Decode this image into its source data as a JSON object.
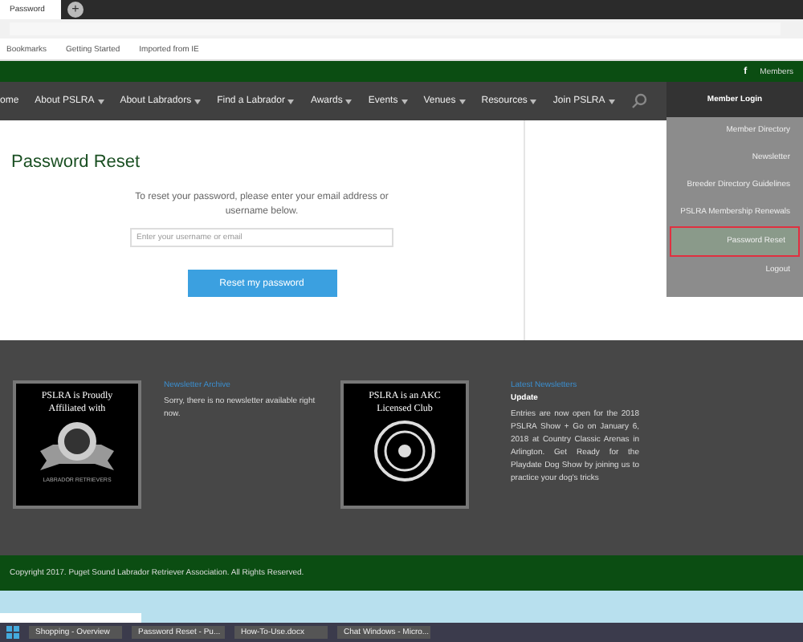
{
  "browser": {
    "tabs": [
      {
        "label": "Password",
        "selected": true
      }
    ],
    "new_tab": "+",
    "bookmarks": [
      "Bookmarks",
      "Getting Started",
      "Imported from IE"
    ]
  },
  "top_bar": {
    "facebook": "f",
    "members": "Members"
  },
  "nav": {
    "items": [
      {
        "label": "ome",
        "dropdown": false
      },
      {
        "label": "About PSLRA",
        "dropdown": true
      },
      {
        "label": "About Labradors",
        "dropdown": true
      },
      {
        "label": "Find a Labrador",
        "dropdown": true
      },
      {
        "label": "Awards",
        "dropdown": true
      },
      {
        "label": "Events",
        "dropdown": true
      },
      {
        "label": "Venues",
        "dropdown": true
      },
      {
        "label": "Resources",
        "dropdown": true
      },
      {
        "label": "Join PSLRA",
        "dropdown": true
      }
    ]
  },
  "members_menu": {
    "title": "Member Login",
    "items": [
      {
        "label": "Member Directory",
        "selected": false
      },
      {
        "label": "Newsletter",
        "selected": false
      },
      {
        "label": "Breeder Directory Guidelines",
        "selected": false
      },
      {
        "label": "PSLRA Membership Renewals",
        "selected": false
      },
      {
        "label": "Password Reset",
        "selected": true
      },
      {
        "label": "Logout",
        "selected": false
      }
    ]
  },
  "content": {
    "title": "Password Reset",
    "instructions": "To reset your password, please enter your email address or username below.",
    "field": {
      "placeholder": "Enter your username or email"
    },
    "button": "Reset my password"
  },
  "footer": {
    "logo_1": {
      "caption": "PSLRA is Proudly Affiliated with",
      "ribbon": "LABRADOR RETRIEVERS"
    },
    "column_1": {
      "heading": "Newsletter Archive",
      "text": "Sorry, there is no newsletter available right now."
    },
    "logo_2": {
      "caption": "PSLRA is an AKC Licensed Club"
    },
    "column_2": {
      "heading": "Latest Newsletters",
      "subheading": "Update",
      "text": "Entries are now open for the 2018 PSLRA Show + Go on January 6, 2018 at Country Classic Arenas in Arlington. Get Ready for the Playdate Dog Show by joining us to practice your dog's tricks"
    }
  },
  "copyright": "Copyright 2017. Puget Sound Labrador Retriever Association. All Rights Reserved.",
  "taskbar": {
    "items": [
      "Shopping - Overview",
      "Password Reset - Pu...",
      "How-To-Use.docx",
      "Chat Windows - Micro..."
    ]
  }
}
